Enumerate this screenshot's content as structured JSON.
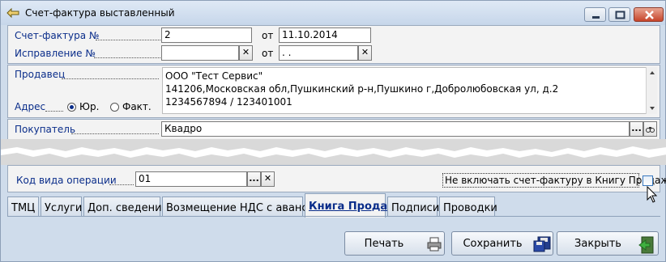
{
  "window": {
    "title": "Счет-фактура выставленный"
  },
  "header": {
    "invoice_label": "Счет-фактура №",
    "invoice_number": "2",
    "invoice_from_label": "от",
    "invoice_date": "11.10.2014",
    "correction_label": "Исправление №",
    "correction_number": "",
    "correction_from_label": "от",
    "correction_date": " .  ."
  },
  "seller": {
    "label": "Продавец",
    "address_label": "Адрес",
    "radio_legal": "Юр.",
    "radio_actual": "Факт.",
    "radio_selected": "Юр.",
    "line1": "ООО \"Тест Сервис\"",
    "line2": "141206,Московская обл,Пушкинский р-н,Пушкино г,Добролюбовская ул, д.2",
    "line3": "1234567894 / 123401001"
  },
  "buyer": {
    "label": "Покупатель",
    "value": "Квадро"
  },
  "operation": {
    "label": "Код вида операции",
    "value": "01"
  },
  "exclude_checkbox": {
    "label": "Не включать счет-фактуру в Книгу Продаж",
    "checked": false
  },
  "tabs": [
    {
      "label": "ТМЦ"
    },
    {
      "label": "Услуги"
    },
    {
      "label": "Доп. сведения"
    },
    {
      "label": "Возмещение НДС с авансов"
    },
    {
      "label": "Книга Продаж"
    },
    {
      "label": "Подписи"
    },
    {
      "label": "Проводки"
    }
  ],
  "active_tab": "Книга Продаж",
  "footer": {
    "print_label": "Печать",
    "save_label": "Сохранить",
    "close_label": "Закрыть"
  },
  "colors": {
    "window_bg": "#cfdceb",
    "panel_bg": "#f3f3f3",
    "label_link": "#0a2d8a"
  }
}
